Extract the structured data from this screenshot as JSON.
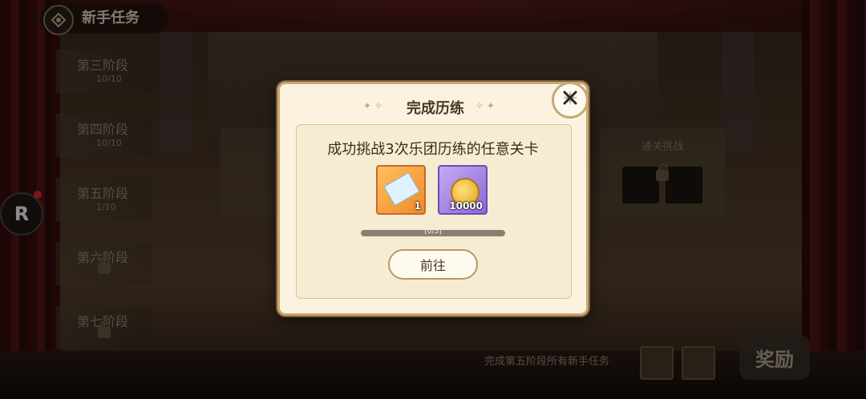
{
  "header": {
    "title": "新手任务",
    "icon": "quest-emblem-icon"
  },
  "stages": [
    {
      "name": "第三阶段",
      "progress": "10/10",
      "locked": false
    },
    {
      "name": "第四阶段",
      "progress": "10/10",
      "locked": false
    },
    {
      "name": "第五阶段",
      "progress": "1/10",
      "locked": false
    },
    {
      "name": "第六阶段",
      "progress": "",
      "locked": true
    },
    {
      "name": "第七阶段",
      "progress": "",
      "locked": true
    }
  ],
  "side": {
    "r_button": "R",
    "badge_color": "#e02a2a"
  },
  "background_cards": {
    "right_title": "通关挑战"
  },
  "bottom": {
    "text": "完成第五阶段所有新手任务",
    "reward_label": "奖励"
  },
  "modal": {
    "title": "完成历练",
    "description": "成功挑战3次乐团历练的任意关卡",
    "rewards": [
      {
        "icon": "ticket-icon",
        "qty": "1"
      },
      {
        "icon": "gold-coin-icon",
        "qty": "10000"
      }
    ],
    "progress": {
      "current": 0,
      "total": 3,
      "label": "[0/3]"
    },
    "go_label": "前往",
    "close_icon": "close-icon"
  }
}
